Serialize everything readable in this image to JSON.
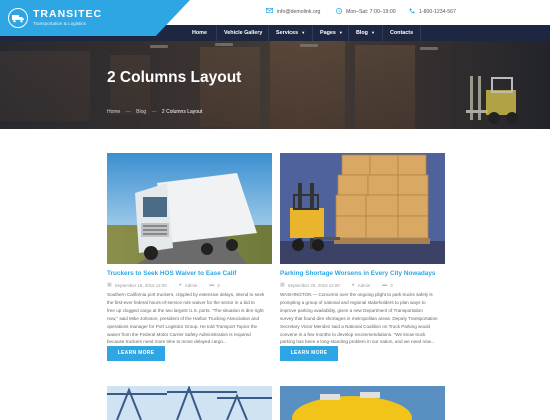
{
  "brand": {
    "name": "TRANSITEC",
    "tagline": "Transportation & Logistics",
    "color": "#2da6e3"
  },
  "contacts": {
    "email": "info@demolink.org",
    "hours": "Mon–Sat: 7:00–19:00",
    "phone": "1-800-1234-567"
  },
  "nav": [
    {
      "label": "Home",
      "caret": false
    },
    {
      "label": "Vehicle Gallery",
      "caret": false
    },
    {
      "label": "Services",
      "caret": true
    },
    {
      "label": "Pages",
      "caret": true
    },
    {
      "label": "Blog",
      "caret": true
    },
    {
      "label": "Contacts",
      "caret": false
    }
  ],
  "hero": {
    "title": "2 Columns Layout",
    "breadcrumb": [
      "Home",
      "Blog",
      "2 Columns Layout"
    ]
  },
  "posts": [
    {
      "title": "Truckers to Seek HOS Waiver to Ease Calif",
      "date": "September 16, 2016 12:00",
      "author": "Admin",
      "comments": "3",
      "excerpt": "Southern California port truckers, crippled by extensive delays, intend to seek\nthe first-ever federal hours-of-service rule waiver for the sector in a bid to\nfree up clogged cargo at the two largest U.S. ports. \"The situation is dire right\nnow,\" said Mike Johnson, president of the Harbor Trucking Association and\noperations manager for Port Logistics Group. He told Transport Topics the\nwaiver from the Federal Motor Carrier Safety Administration is required\nbecause truckers need more time to move delayed cargo...",
      "button": "LEARN MORE"
    },
    {
      "title": "Parking Shortage Worsens in Every City Nowadays",
      "date": "September 26, 2016 12:00",
      "author": "Admin",
      "comments": "3",
      "excerpt": "WASHINGTON — Concerns over the ongoing plight to park trucks safely is\nprompting a group of national and regional stakeholders to plan ways to\nimprove parking availability, given a new Department of Transportation\nsurvey that found dire shortages in metropolitan areas. Deputy Transportation\nSecretary Victor Mendez said a National Coalition on Truck Parking would\nconvene in a few months to develop recommendations. \"We know truck\nparking has been a long-standing problem in our nation, and we need now...",
      "button": "LEARN MORE"
    }
  ]
}
